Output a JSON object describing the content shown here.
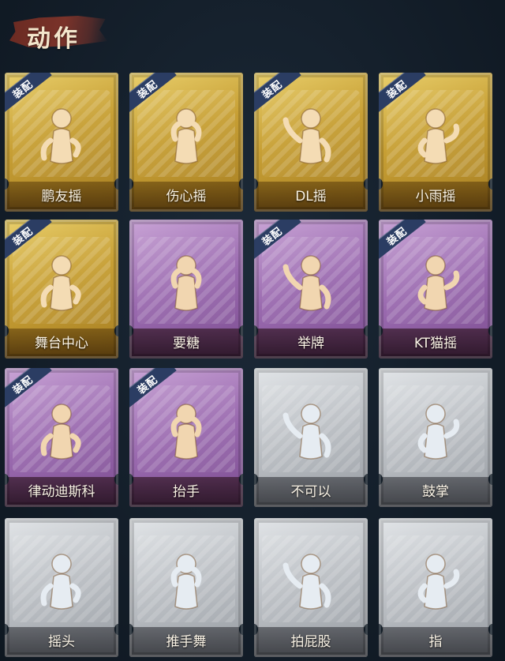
{
  "header": {
    "title": "动作"
  },
  "equipped_badge": "装配",
  "cards": [
    {
      "label": "鹏友摇",
      "tier": "gold",
      "equipped": true,
      "icon": "dance-figure-icon"
    },
    {
      "label": "伤心摇",
      "tier": "gold",
      "equipped": true,
      "icon": "heart-hands-figure-icon"
    },
    {
      "label": "DL摇",
      "tier": "gold",
      "equipped": true,
      "icon": "disco-point-figure-icon"
    },
    {
      "label": "小雨摇",
      "tier": "gold",
      "equipped": true,
      "icon": "arm-wave-figure-icon"
    },
    {
      "label": "舞台中心",
      "tier": "gold",
      "equipped": true,
      "icon": "stage-pose-figure-icon"
    },
    {
      "label": "要糖",
      "tier": "purple",
      "equipped": false,
      "icon": "ask-candy-figure-icon"
    },
    {
      "label": "举牌",
      "tier": "purple",
      "equipped": true,
      "icon": "hold-sign-figure-icon"
    },
    {
      "label": "KT猫摇",
      "tier": "purple",
      "equipped": true,
      "icon": "cat-dance-figure-icon"
    },
    {
      "label": "律动迪斯科",
      "tier": "purple",
      "equipped": true,
      "icon": "disco-rhythm-figure-icon"
    },
    {
      "label": "抬手",
      "tier": "purple",
      "equipped": true,
      "icon": "raise-hand-figure-icon"
    },
    {
      "label": "不可以",
      "tier": "gray",
      "equipped": false,
      "icon": "finger-wag-icon"
    },
    {
      "label": "鼓掌",
      "tier": "gray",
      "equipped": false,
      "icon": "clap-hands-icon"
    },
    {
      "label": "摇头",
      "tier": "gray",
      "equipped": false,
      "icon": "head-shake-figure-icon"
    },
    {
      "label": "推手舞",
      "tier": "gray",
      "equipped": false,
      "icon": "push-dance-figure-icon"
    },
    {
      "label": "拍屁股",
      "tier": "gray",
      "equipped": false,
      "icon": "butt-slap-figure-icon"
    },
    {
      "label": "指",
      "tier": "gray",
      "equipped": false,
      "icon": "point-hand-icon"
    }
  ],
  "colors": {
    "gold": "#c79f34",
    "purple": "#9a6aaf",
    "gray": "#b9bdc2",
    "badge": "#2b3d63",
    "figure_gold": "#f4dcb4",
    "figure_purple": "#f1d6b0",
    "figure_gray": "#e6ecf2"
  }
}
